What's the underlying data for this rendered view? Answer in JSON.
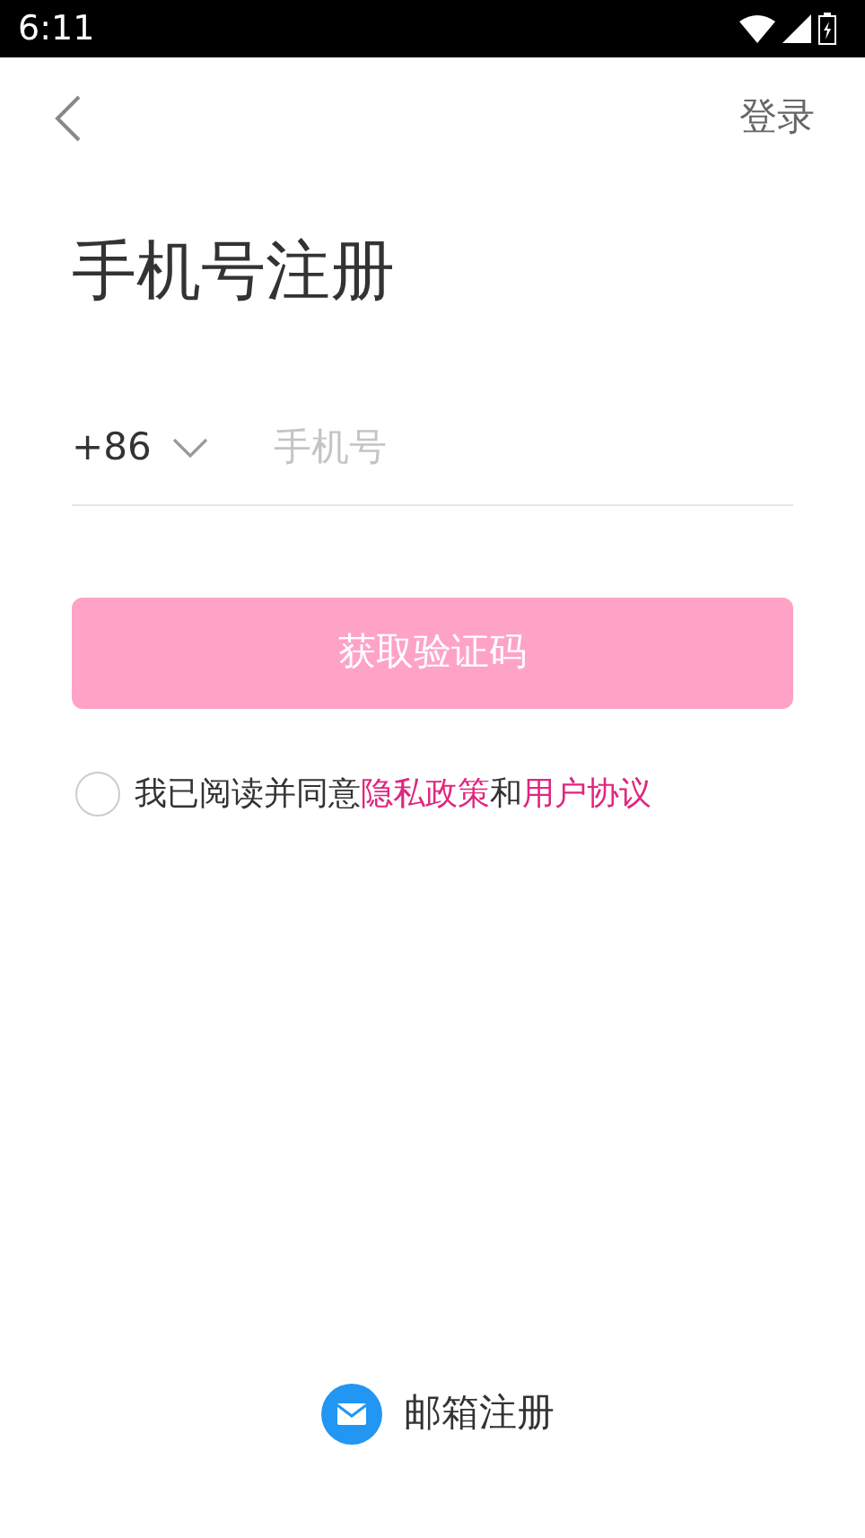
{
  "status_bar": {
    "time": "6:11"
  },
  "header": {
    "action": "登录"
  },
  "title": "手机号注册",
  "phone": {
    "country_code": "+86",
    "placeholder": "手机号"
  },
  "submit": {
    "label": "获取验证码",
    "disabled": true
  },
  "agreement": {
    "checked": false,
    "parts": [
      {
        "kind": "plain",
        "text": "我已阅读并同意"
      },
      {
        "kind": "link",
        "text": "隐私政策"
      },
      {
        "kind": "plain",
        "text": "和"
      },
      {
        "kind": "link",
        "text": "用户协议"
      }
    ]
  },
  "alt_signup": {
    "label": "邮箱注册"
  }
}
